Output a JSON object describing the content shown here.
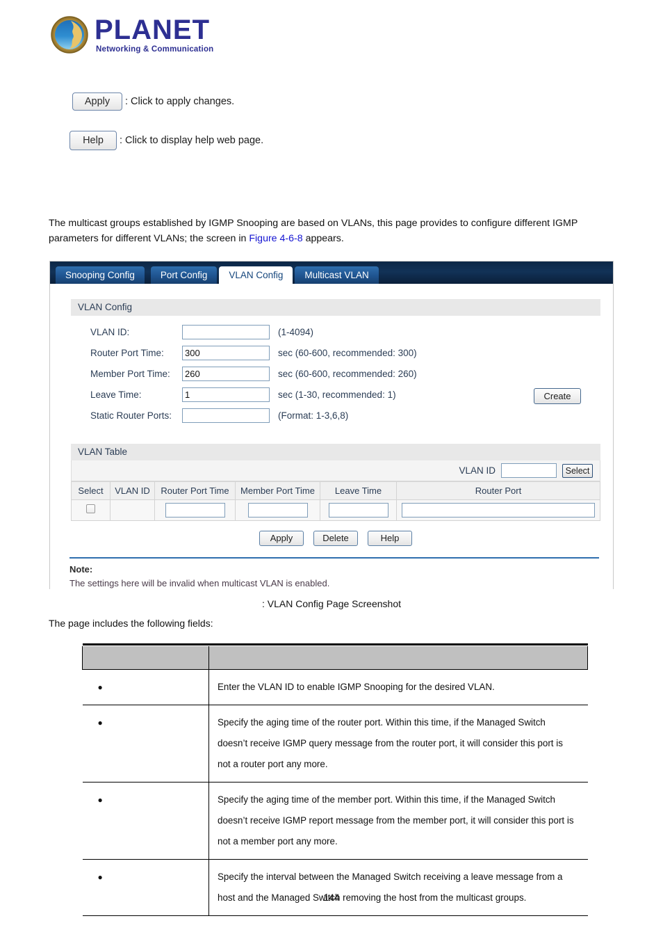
{
  "brand": {
    "name": "PLANET",
    "tagline": "Networking & Communication",
    "logo_icon": "planet-globe-logo"
  },
  "legend": [
    {
      "button_label": "Apply",
      "description": ": Click to apply changes."
    },
    {
      "button_label": "Help",
      "description": ": Click to display help web page."
    }
  ],
  "intro": {
    "text_before": "The multicast groups established by IGMP Snooping are based on VLANs, this page provides to configure different IGMP parameters for different VLANs; the screen in ",
    "figure_link": "Figure 4-6-8",
    "text_after": " appears."
  },
  "switch_ui": {
    "tabs": [
      {
        "label": "Snooping Config",
        "active": false
      },
      {
        "label": "Port Config",
        "active": false
      },
      {
        "label": "VLAN Config",
        "active": true
      },
      {
        "label": "Multicast VLAN",
        "active": false
      }
    ],
    "vlan_config": {
      "section_title": "VLAN Config",
      "fields": [
        {
          "label": "VLAN ID:",
          "value": "",
          "hint": "(1-4094)"
        },
        {
          "label": "Router Port Time:",
          "value": "300",
          "hint": "sec (60-600, recommended: 300)"
        },
        {
          "label": "Member Port Time:",
          "value": "260",
          "hint": "sec (60-600, recommended: 260)"
        },
        {
          "label": "Leave Time:",
          "value": "1",
          "hint": "sec (1-30, recommended: 1)"
        },
        {
          "label": "Static Router Ports:",
          "value": "",
          "hint": "(Format: 1-3,6,8)"
        }
      ],
      "create_button": "Create"
    },
    "vlan_table": {
      "section_title": "VLAN Table",
      "filter_label": "VLAN ID",
      "filter_value": "",
      "select_button": "Select",
      "columns": [
        "Select",
        "VLAN ID",
        "Router Port Time",
        "Member Port Time",
        "Leave Time",
        "Router Port"
      ],
      "rows": [
        {
          "select": false,
          "vlan_id": "",
          "router_port_time": "",
          "member_port_time": "",
          "leave_time": "",
          "router_port": ""
        }
      ]
    },
    "buttons": [
      "Apply",
      "Delete",
      "Help"
    ],
    "note": {
      "title": "Note:",
      "text": "The settings here will be invalid when multicast VLAN is enabled."
    }
  },
  "caption": ": VLAN Config Page Screenshot",
  "lead_in": "The page includes the following fields:",
  "fields_table": {
    "headers": [
      "",
      ""
    ],
    "rows": [
      {
        "object": "",
        "description": "Enter the VLAN ID to enable IGMP Snooping for the desired VLAN."
      },
      {
        "object": "",
        "description": "Specify the aging time of the router port. Within this time, if the Managed Switch doesn’t receive IGMP query message from the router port, it will consider this port is not a router port any more."
      },
      {
        "object": "",
        "description": "Specify the aging time of the member port. Within this time, if the Managed Switch doesn’t receive IGMP report message from the member port, it will consider this port is not a member port any more."
      },
      {
        "object": "",
        "description": "Specify the interval between the Managed Switch receiving a leave message from a host and the Managed Switch removing the host from the multicast groups."
      }
    ]
  },
  "page_number": "144",
  "colors": {
    "brand_blue": "#2d2f92",
    "tab_active_text": "#14457c",
    "tabbar_dark": "#0c2746",
    "tab_blue": "#1f5490",
    "link_blue": "#1414d2",
    "note_rule": "#2f6fae"
  }
}
